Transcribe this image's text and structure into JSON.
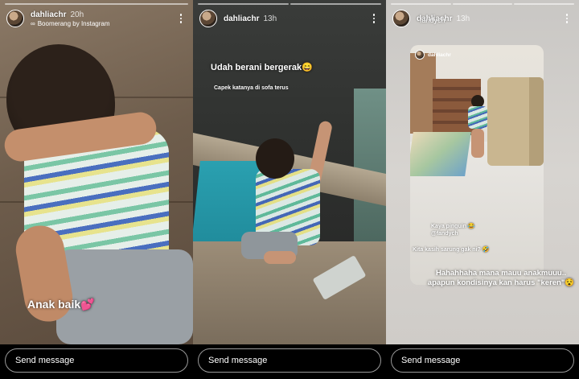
{
  "stories": [
    {
      "username": "dahliachr",
      "time": "20h",
      "subline": "Boomerang by Instagram",
      "caption": "Anak baik💕",
      "send_placeholder": "Send message"
    },
    {
      "username": "dahliachr",
      "time": "13h",
      "caption_main": "Udah berani bergerak😄",
      "caption_sub": "Capek katanya di sofa terus",
      "send_placeholder": "Send message"
    },
    {
      "username": "dahliachr",
      "time": "13h",
      "tag_overlay": "fandych",
      "inner_username": "dahliachr",
      "caption_1": "Kaya pinguin 😂\n@fandych",
      "caption_2": "Kita kasih sarung gak ni? 🤣",
      "caption_main": "Hahahhaha mana mauu anakmuuu.. apapun kondisinya kan harus \"keren\"😵",
      "send_placeholder": "Send message"
    }
  ],
  "icons": {
    "more": "more-vertical-icon",
    "boomerang": "infinity-icon"
  }
}
